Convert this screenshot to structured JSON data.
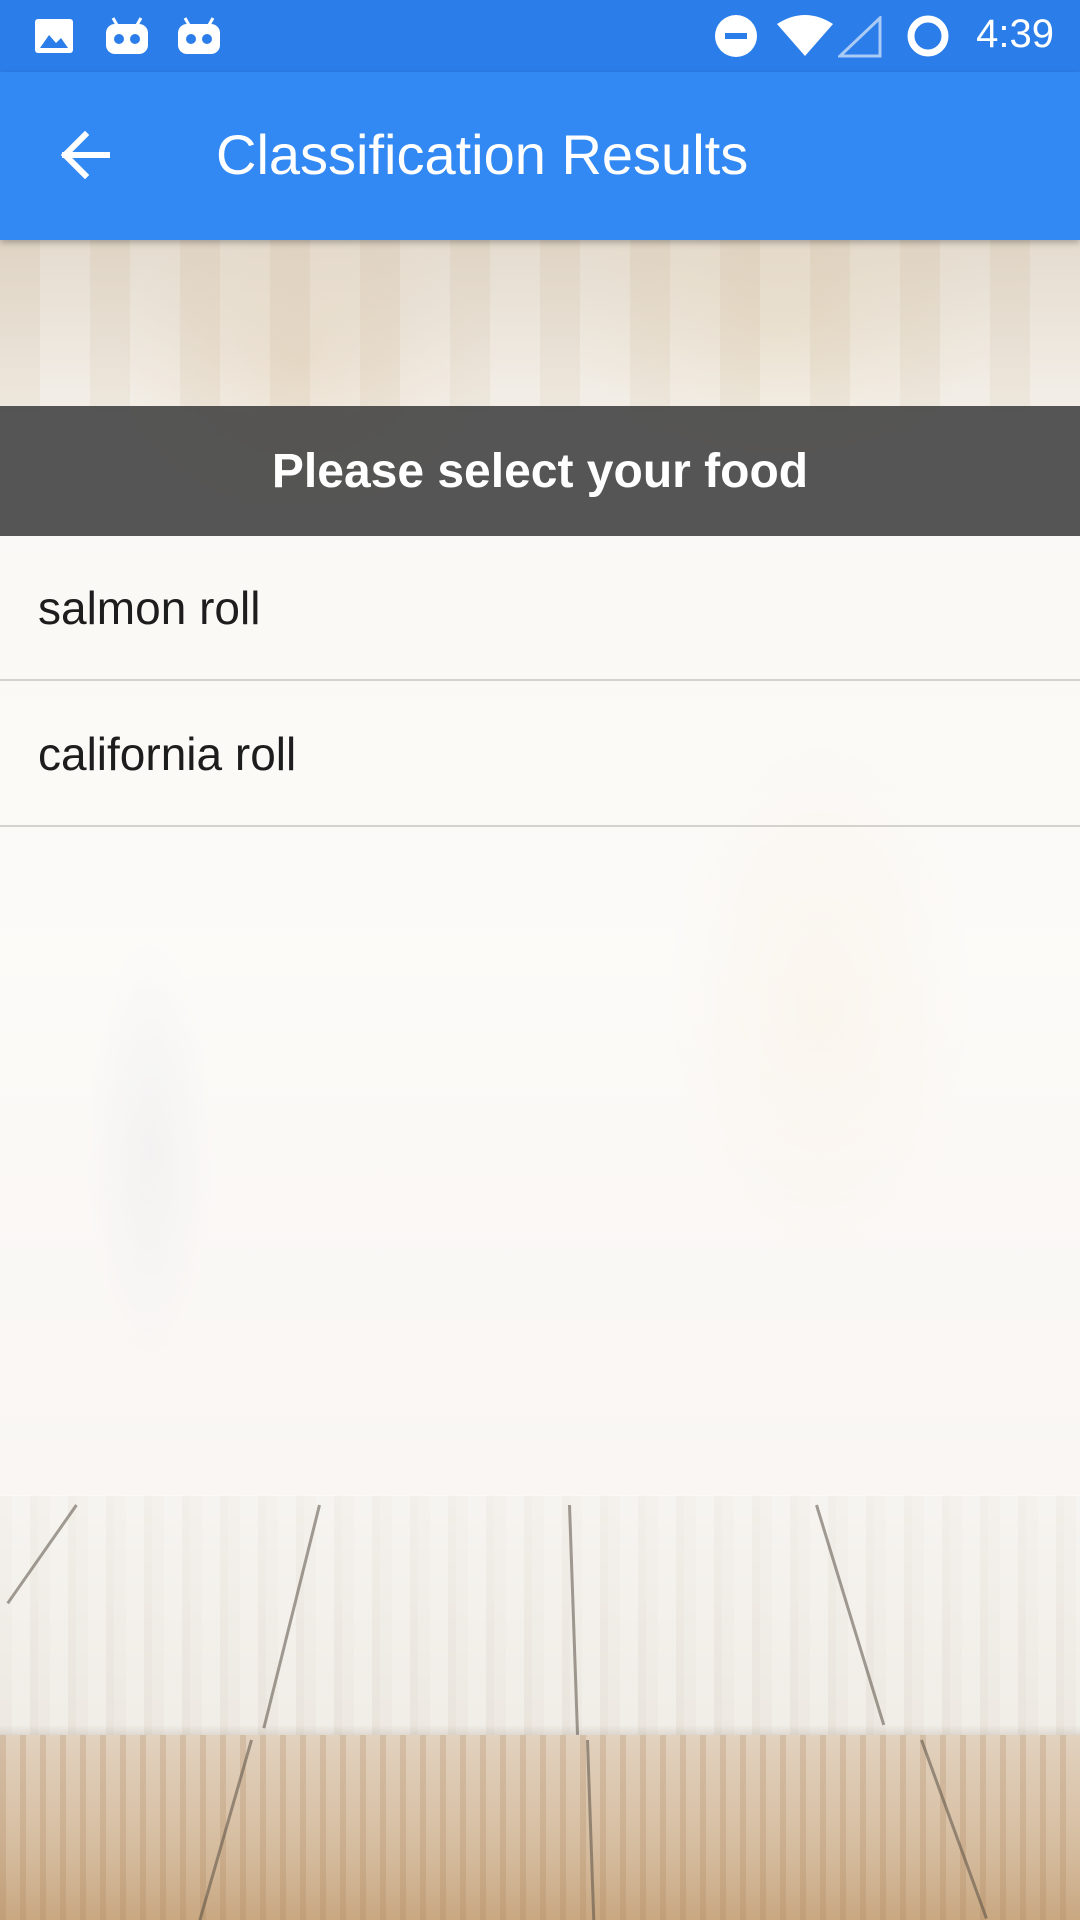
{
  "status_bar": {
    "time": "4:39",
    "left_icons": [
      "image-icon",
      "android-robot-icon",
      "android-robot-icon"
    ],
    "right_icons": [
      "do-not-disturb-icon",
      "wifi-icon",
      "cell-signal-icon",
      "loading-ring-icon"
    ]
  },
  "app_bar": {
    "title": "Classification Results",
    "back_icon": "arrow-back-icon",
    "color": "#3389f4"
  },
  "banner": {
    "title": "Please select your food",
    "color": "#484848"
  },
  "results": [
    {
      "label": "salmon roll"
    },
    {
      "label": "california roll"
    }
  ]
}
